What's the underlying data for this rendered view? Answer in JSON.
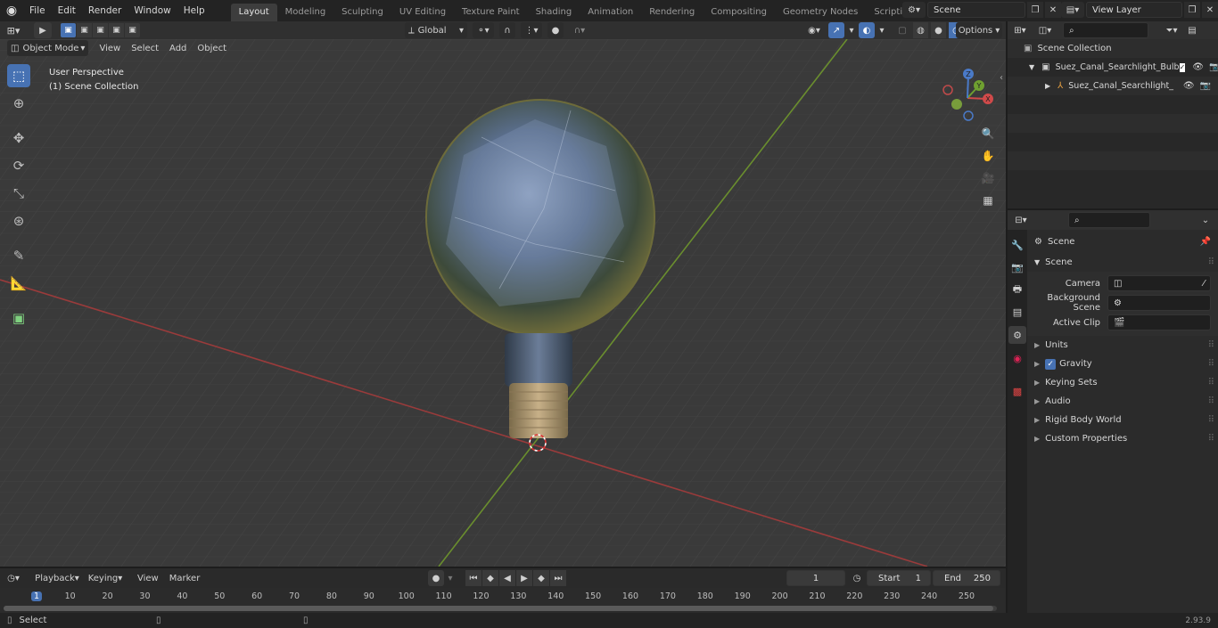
{
  "menu": [
    "File",
    "Edit",
    "Render",
    "Window",
    "Help"
  ],
  "workspaces": [
    {
      "label": "Layout",
      "active": true
    },
    {
      "label": "Modeling",
      "active": false
    },
    {
      "label": "Sculpting",
      "active": false
    },
    {
      "label": "UV Editing",
      "active": false
    },
    {
      "label": "Texture Paint",
      "active": false
    },
    {
      "label": "Shading",
      "active": false
    },
    {
      "label": "Animation",
      "active": false
    },
    {
      "label": "Rendering",
      "active": false
    },
    {
      "label": "Compositing",
      "active": false
    },
    {
      "label": "Geometry Nodes",
      "active": false
    },
    {
      "label": "Scripting",
      "active": false
    }
  ],
  "add_workspace": "+",
  "scene_name": "Scene",
  "view_layer": "View Layer",
  "viewport_header": {
    "mode": "Object Mode",
    "menus": [
      "View",
      "Select",
      "Add",
      "Object"
    ],
    "transform_orientation": "Global",
    "options": "Options"
  },
  "viewport": {
    "perspective": "User Perspective",
    "collection": "(1) Scene Collection",
    "gizmo": {
      "z": "Z",
      "y": "Y",
      "x": "X"
    }
  },
  "tools": [
    "select-box-icon",
    "cursor-icon",
    "move-icon",
    "rotate-icon",
    "scale-icon",
    "transform-icon",
    "annotate-icon",
    "measure-icon",
    "add-cube-icon"
  ],
  "outliner": {
    "root": "Scene Collection",
    "items": [
      {
        "label": "Suez_Canal_Searchlight_Bulb",
        "indent": 1,
        "type": "collection"
      },
      {
        "label": "Suez_Canal_Searchlight_",
        "indent": 2,
        "type": "object"
      }
    ]
  },
  "properties": {
    "context": "Scene",
    "section": "Scene",
    "fields": [
      {
        "label": "Camera",
        "value": ""
      },
      {
        "label": "Background Scene",
        "value": ""
      },
      {
        "label": "Active Clip",
        "value": ""
      }
    ],
    "panels": [
      "Units",
      "Gravity",
      "Keying Sets",
      "Audio",
      "Rigid Body World",
      "Custom Properties"
    ],
    "gravity_checked": true
  },
  "timeline": {
    "menus": [
      "Playback",
      "Keying",
      "View",
      "Marker"
    ],
    "current_frame": "1",
    "start_label": "Start",
    "start": "1",
    "end_label": "End",
    "end": "250",
    "ruler": [
      "1",
      "10",
      "20",
      "30",
      "40",
      "50",
      "60",
      "70",
      "80",
      "90",
      "100",
      "110",
      "120",
      "130",
      "140",
      "150",
      "160",
      "170",
      "180",
      "190",
      "200",
      "210",
      "220",
      "230",
      "240",
      "250"
    ]
  },
  "status": {
    "left": "Select",
    "version": "2.93.9"
  }
}
